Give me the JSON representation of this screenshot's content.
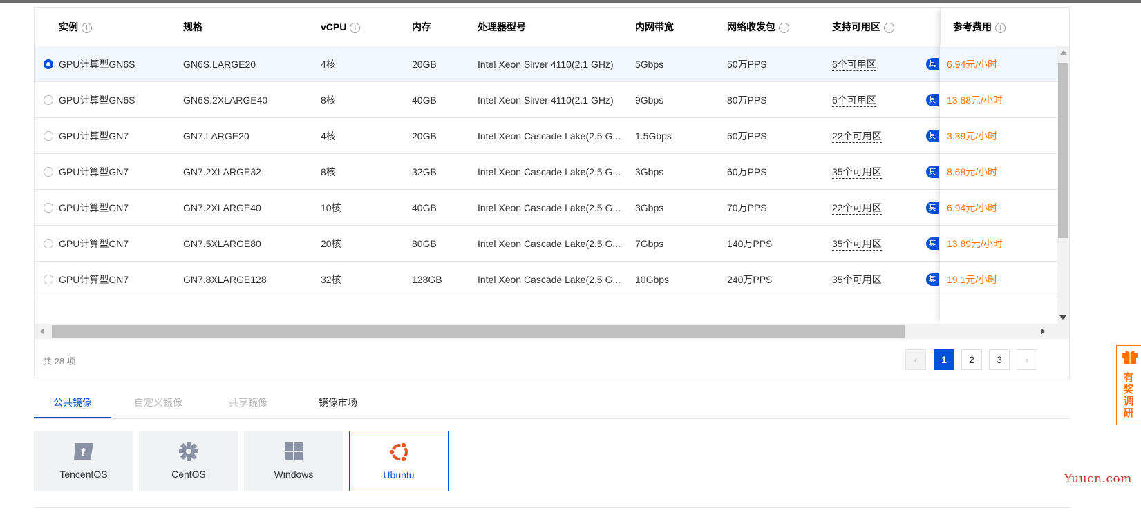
{
  "table": {
    "headers": {
      "instance": "实例",
      "spec": "规格",
      "vcpu": "vCPU",
      "memory": "内存",
      "processor": "处理器型号",
      "bandwidth": "内网带宽",
      "pps": "网络收发包",
      "zones": "支持可用区",
      "price": "参考费用"
    },
    "info_glyph": "i",
    "zone_badge": "其",
    "rows": [
      {
        "instance": "GPU计算型GN6S",
        "spec": "GN6S.LARGE20",
        "vcpu": "4核",
        "memory": "20GB",
        "processor": "Intel Xeon Sliver 4110(2.1 GHz)",
        "bandwidth": "5Gbps",
        "pps": "50万PPS",
        "zones": "6个可用区",
        "price": "6.94元/小时",
        "selected": true
      },
      {
        "instance": "GPU计算型GN6S",
        "spec": "GN6S.2XLARGE40",
        "vcpu": "8核",
        "memory": "40GB",
        "processor": "Intel Xeon Sliver 4110(2.1 GHz)",
        "bandwidth": "9Gbps",
        "pps": "80万PPS",
        "zones": "6个可用区",
        "price": "13.88元/小时",
        "selected": false
      },
      {
        "instance": "GPU计算型GN7",
        "spec": "GN7.LARGE20",
        "vcpu": "4核",
        "memory": "20GB",
        "processor": "Intel Xeon Cascade Lake(2.5 G...",
        "bandwidth": "1.5Gbps",
        "pps": "50万PPS",
        "zones": "22个可用区",
        "price": "3.39元/小时",
        "selected": false
      },
      {
        "instance": "GPU计算型GN7",
        "spec": "GN7.2XLARGE32",
        "vcpu": "8核",
        "memory": "32GB",
        "processor": "Intel Xeon Cascade Lake(2.5 G...",
        "bandwidth": "3Gbps",
        "pps": "60万PPS",
        "zones": "35个可用区",
        "price": "8.68元/小时",
        "selected": false
      },
      {
        "instance": "GPU计算型GN7",
        "spec": "GN7.2XLARGE40",
        "vcpu": "10核",
        "memory": "40GB",
        "processor": "Intel Xeon Cascade Lake(2.5 G...",
        "bandwidth": "3Gbps",
        "pps": "70万PPS",
        "zones": "22个可用区",
        "price": "6.94元/小时",
        "selected": false
      },
      {
        "instance": "GPU计算型GN7",
        "spec": "GN7.5XLARGE80",
        "vcpu": "20核",
        "memory": "80GB",
        "processor": "Intel Xeon Cascade Lake(2.5 G...",
        "bandwidth": "7Gbps",
        "pps": "140万PPS",
        "zones": "35个可用区",
        "price": "13.89元/小时",
        "selected": false
      },
      {
        "instance": "GPU计算型GN7",
        "spec": "GN7.8XLARGE128",
        "vcpu": "32核",
        "memory": "128GB",
        "processor": "Intel Xeon Cascade Lake(2.5 G...",
        "bandwidth": "10Gbps",
        "pps": "240万PPS",
        "zones": "35个可用区",
        "price": "19.1元/小时",
        "selected": false
      }
    ]
  },
  "footer": {
    "total": "共 28 项",
    "pages": [
      "1",
      "2",
      "3"
    ],
    "current_page": "1",
    "prev_glyph": "‹",
    "next_glyph": "›"
  },
  "image_tabs": {
    "items": [
      {
        "label": "公共镜像",
        "state": "active"
      },
      {
        "label": "自定义镜像",
        "state": "disabled"
      },
      {
        "label": "共享镜像",
        "state": "disabled"
      },
      {
        "label": "镜像市场",
        "state": "normal"
      }
    ]
  },
  "os_options": [
    {
      "name": "TencentOS",
      "icon": "tencentos-icon",
      "selected": false
    },
    {
      "name": "CentOS",
      "icon": "centos-icon",
      "selected": false
    },
    {
      "name": "Windows",
      "icon": "windows-icon",
      "selected": false
    },
    {
      "name": "Ubuntu",
      "icon": "ubuntu-icon",
      "selected": true
    }
  ],
  "survey": {
    "label": "有奖调研"
  },
  "watermark": "Yuucn.com",
  "colors": {
    "primary": "#0052d9",
    "price": "#ff7200",
    "selected_row": "#f2f6fd",
    "ubuntu": "#e95420"
  }
}
